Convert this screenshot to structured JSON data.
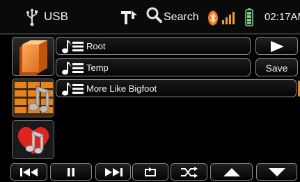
{
  "status": {
    "source_label": "USB",
    "search_label": "Search",
    "time": "02:17AM",
    "icons": [
      "usb-icon",
      "folder-up-icon",
      "search-icon",
      "bluetooth-icon",
      "signal-icon",
      "battery-icon"
    ]
  },
  "categories": [
    {
      "name": "folders",
      "icon": "folder-icon",
      "selected": true
    },
    {
      "name": "songs",
      "icon": "music-grid-icon",
      "selected": false
    },
    {
      "name": "favorites",
      "icon": "heart-music-icon",
      "selected": false
    }
  ],
  "files": [
    {
      "name": "Root",
      "icon": "music-list-icon"
    },
    {
      "name": "Temp",
      "icon": "music-list-icon"
    },
    {
      "name": "More Like Bigfoot",
      "icon": "music-list-icon"
    }
  ],
  "actions": {
    "play_icon": "play-icon",
    "save_label": "Save"
  },
  "transport": [
    "previous-icon",
    "pause-icon",
    "next-icon",
    "repeat-icon",
    "shuffle-icon",
    "up-arrow-icon",
    "down-arrow-icon"
  ],
  "colors": {
    "background": "#000000",
    "accent_orange": "#e8821e",
    "text": "#f4f4f4",
    "border": "#8a8a8a"
  }
}
